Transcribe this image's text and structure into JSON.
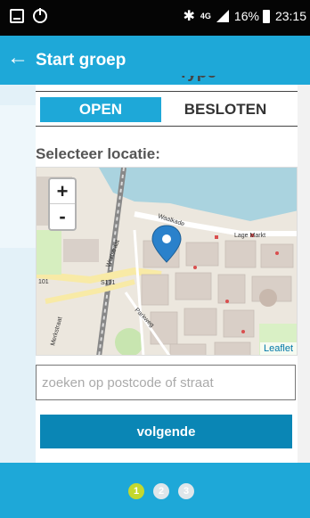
{
  "status_bar": {
    "network": "4G",
    "battery": "16%",
    "time": "23:15",
    "icons": [
      "gallery-icon",
      "power-icon",
      "bluetooth-icon",
      "signal-icon",
      "battery-icon"
    ]
  },
  "app_bar": {
    "title": "Start groep",
    "back_icon": "arrow-left-icon"
  },
  "type_section": {
    "partial_label": "Type"
  },
  "toggle": {
    "open_label": "OPEN",
    "closed_label": "BESLOTEN",
    "selected": "OPEN"
  },
  "location": {
    "label": "Selecteer locatie:"
  },
  "map": {
    "zoom_in": "+",
    "zoom_out": "-",
    "attribution": "Leaflet",
    "labels": {
      "waalkade": "Waalkade",
      "lage_markt": "Lage Markt",
      "s101": "S101",
      "wertstraat": "Wertstraat",
      "parkweg": "Parkweg",
      "merkstraat": "Merkstraat",
      "nummer": "101"
    },
    "colors": {
      "water": "#aad3df",
      "road_yellow": "#f8eaa6",
      "pin": "#2a81cb"
    }
  },
  "search": {
    "placeholder": "zoeken op postcode of straat",
    "value": ""
  },
  "next_button": {
    "label": "volgende"
  },
  "steps": {
    "items": [
      "1",
      "2",
      "3"
    ],
    "active": "1"
  },
  "colors": {
    "primary": "#1ea8d8",
    "button": "#0a86b5",
    "active_step": "#c4d82e"
  }
}
